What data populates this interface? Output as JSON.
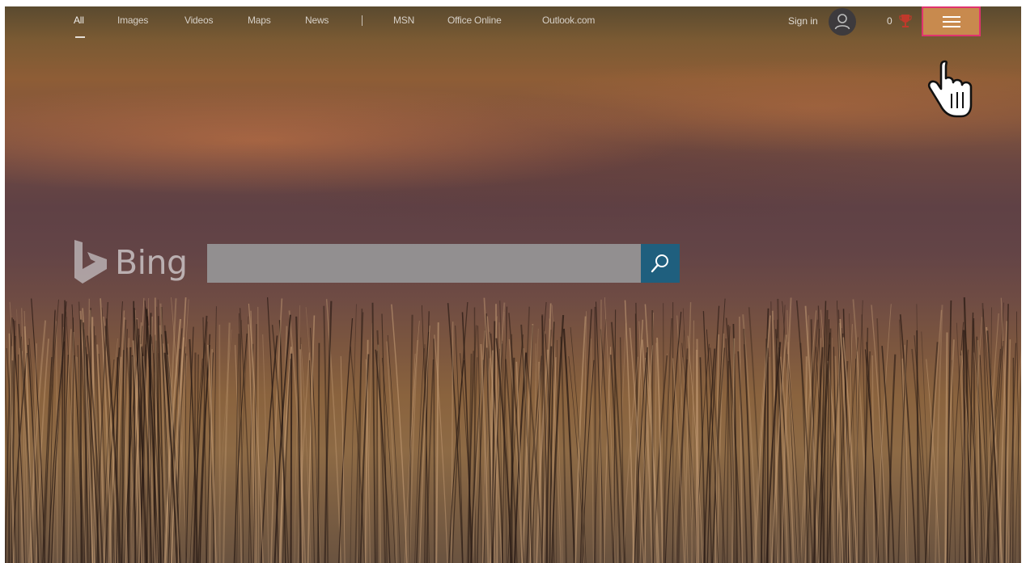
{
  "nav": {
    "items": [
      {
        "label": "All",
        "active": true
      },
      {
        "label": "Images"
      },
      {
        "label": "Videos"
      },
      {
        "label": "Maps"
      },
      {
        "label": "News"
      },
      {
        "label": "MSN"
      },
      {
        "label": "Office Online"
      },
      {
        "label": "Outlook.com"
      }
    ]
  },
  "account": {
    "signin_label": "Sign in",
    "avatar_icon": "user-icon"
  },
  "rewards": {
    "count": "0",
    "icon": "trophy-icon",
    "icon_color": "#c0392b"
  },
  "menu": {
    "icon": "hamburger-icon",
    "background_color": "#c88a4e",
    "highlight_color": "#e0336e"
  },
  "brand": {
    "name": "Bing"
  },
  "search": {
    "value": "",
    "button_icon": "search-icon",
    "button_color": "#1f5f7e"
  },
  "cursor": {
    "icon": "hand-pointer-icon"
  }
}
